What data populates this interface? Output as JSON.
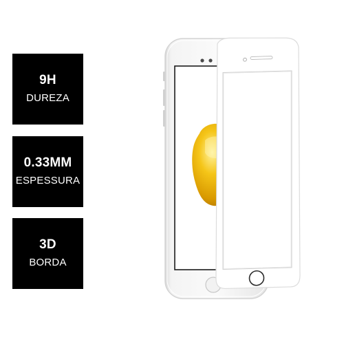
{
  "features": [
    {
      "value": "9H",
      "label": "DUREZA"
    },
    {
      "value": "0.33MM",
      "label": "ESPESSURA"
    },
    {
      "value": "3D",
      "label": "BORDA"
    }
  ],
  "product_image": {
    "icon": "phone-with-screen-protector-icon",
    "phone_color": "#eaeaea",
    "logo_color": "#e2a800"
  }
}
